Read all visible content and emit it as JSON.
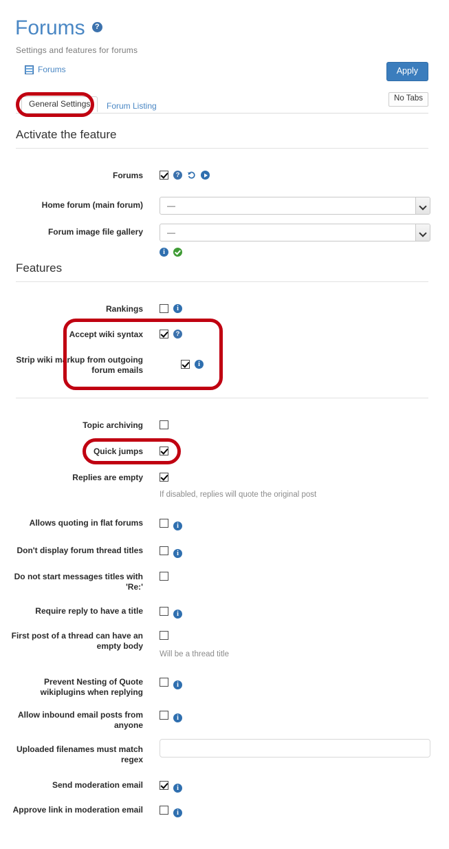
{
  "header": {
    "title": "Forums",
    "title_help_icon": "help-circle-icon",
    "subtitle": "Settings and features for forums",
    "breadcrumb": {
      "icon": "list-icon",
      "label": "Forums"
    },
    "apply_label": "Apply",
    "no_tabs_label": "No Tabs"
  },
  "tabs": [
    {
      "label": "General Settings",
      "active": true
    },
    {
      "label": "Forum Listing",
      "active": false
    }
  ],
  "sections": [
    {
      "id": "activate",
      "heading": "Activate the feature"
    },
    {
      "id": "features",
      "heading": "Features"
    }
  ],
  "activate": {
    "forums": {
      "label": "Forums",
      "checked": true,
      "icons": [
        "question-icon",
        "undo-icon",
        "play-icon"
      ]
    },
    "home_forum": {
      "label": "Home forum (main forum)",
      "value": "—"
    },
    "image_gallery": {
      "label": "Forum image file gallery",
      "value": "—",
      "icons": [
        "info-icon",
        "check-circle-icon"
      ]
    }
  },
  "features": {
    "rankings": {
      "label": "Rankings",
      "checked": false,
      "icons": [
        "info-icon"
      ]
    },
    "accept_wiki_syntax": {
      "label": "Accept wiki syntax",
      "checked": true,
      "icons": [
        "question-icon"
      ]
    },
    "strip_wiki_markup": {
      "label": "Strip wiki markup from outgoing forum emails",
      "checked": true,
      "icons": [
        "info-icon"
      ]
    },
    "topic_archiving": {
      "label": "Topic archiving",
      "checked": false,
      "icons": []
    },
    "quick_jumps": {
      "label": "Quick jumps",
      "checked": true,
      "icons": []
    },
    "replies_are_empty": {
      "label": "Replies are empty",
      "checked": true,
      "icons": [],
      "hint": "If disabled, replies will quote the original post"
    },
    "allows_quoting_flat": {
      "label": "Allows quoting in flat forums",
      "checked": false,
      "icons": [
        "info-icon"
      ]
    },
    "dont_display_thread_titles": {
      "label": "Don't display forum thread titles",
      "checked": false,
      "icons": [
        "info-icon"
      ]
    },
    "no_re_prefix": {
      "label": "Do not start messages titles with 'Re:'",
      "checked": false,
      "icons": []
    },
    "require_reply_title": {
      "label": "Require reply to have a title",
      "checked": false,
      "icons": [
        "info-icon"
      ]
    },
    "first_post_empty_body": {
      "label": "First post of a thread can have an empty body",
      "checked": false,
      "icons": [],
      "hint": "Will be a thread title"
    },
    "prevent_nesting_quote": {
      "label": "Prevent Nesting of Quote wikiplugins when replying",
      "checked": false,
      "icons": [
        "info-icon"
      ]
    },
    "allow_inbound_email": {
      "label": "Allow inbound email posts from anyone",
      "checked": false,
      "icons": [
        "info-icon"
      ]
    },
    "filename_regex": {
      "label": "Uploaded filenames must match regex",
      "value": "",
      "placeholder": ""
    },
    "send_moderation_email": {
      "label": "Send moderation email",
      "checked": true,
      "icons": [
        "info-icon"
      ]
    },
    "approve_link_moderation": {
      "label": "Approve link in moderation email",
      "checked": false,
      "icons": [
        "info-icon"
      ]
    }
  },
  "annotations": {
    "color": "#c00011",
    "boxes": [
      "general-settings-tab",
      "wiki-syntax-group",
      "quick-jumps-row"
    ]
  },
  "colors": {
    "title_blue": "#4a87c4",
    "link_blue": "#4a87c4",
    "apply_button": "#3b7dbd",
    "annotation_red": "#c00011",
    "info_icon_blue": "#2f6faf",
    "success_green": "#3f9b35"
  }
}
